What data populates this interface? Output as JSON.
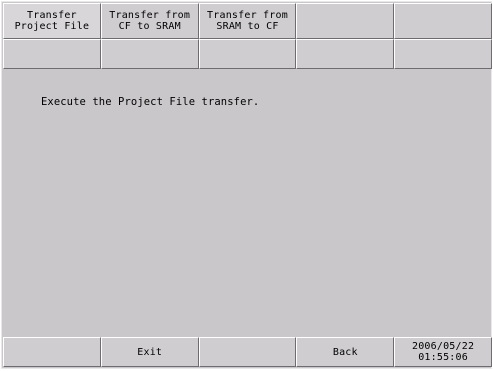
{
  "tabs": [
    {
      "label": "Transfer\nProject File"
    },
    {
      "label": "Transfer from\nCF to SRAM"
    },
    {
      "label": "Transfer from\nSRAM to CF"
    },
    {
      "label": ""
    },
    {
      "label": ""
    }
  ],
  "second_row": [
    "",
    "",
    "",
    "",
    ""
  ],
  "main": {
    "message": "Execute the Project File transfer."
  },
  "bottom": {
    "slot1": "",
    "exit_label": "Exit",
    "slot3": "",
    "back_label": "Back",
    "date": "2006/05/22",
    "time": "01:55:06"
  },
  "colors": {
    "background": "#c9c7ca",
    "button": "#cfcdd0"
  }
}
